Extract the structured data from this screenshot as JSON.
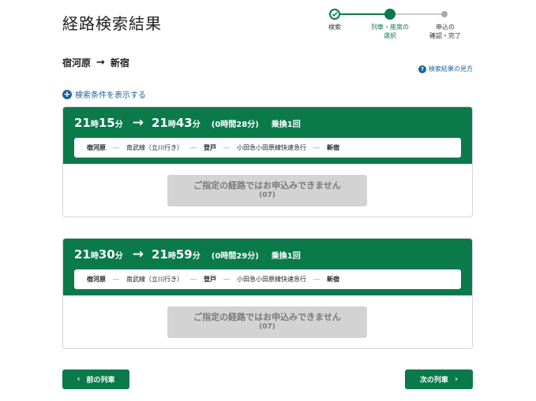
{
  "page": {
    "title": "経路検索結果"
  },
  "stepper": {
    "steps": [
      {
        "label": "検索",
        "state": "done"
      },
      {
        "label": "列車・座席の\n選択",
        "state": "current"
      },
      {
        "label": "申込の\n確認・完了",
        "state": "todo"
      }
    ]
  },
  "route": {
    "from": "宿河原",
    "arrow": "→",
    "to": "新宿"
  },
  "help_link": {
    "label": "検索結果の見方",
    "icon": "question-icon"
  },
  "conditions_link": {
    "label": "検索条件を表示する",
    "icon": "plus-circle-icon"
  },
  "results": [
    {
      "dep_hour": "21",
      "dep_min": "15",
      "arr_hour": "21",
      "arr_min": "43",
      "duration": "(0時間28分)",
      "transfers": "乗換1回",
      "segments": [
        "宿河原",
        "南武線（立川行き）",
        "登戸",
        "小田急小田原線快速急行",
        "新宿"
      ],
      "message": "ご指定の経路ではお申込みできません",
      "code": "(07)"
    },
    {
      "dep_hour": "21",
      "dep_min": "30",
      "arr_hour": "21",
      "arr_min": "59",
      "duration": "(0時間29分)",
      "transfers": "乗換1回",
      "segments": [
        "宿河原",
        "南武線（立川行き）",
        "登戸",
        "小田急小田原線快速急行",
        "新宿"
      ],
      "message": "ご指定の経路ではお申込みできません",
      "code": "(07)"
    }
  ],
  "labels": {
    "hour_unit": "時",
    "min_unit": "分",
    "arrow": "→",
    "dash": "―"
  },
  "buttons": {
    "prev": "前の列車",
    "next": "次の列車"
  },
  "colors": {
    "brand_green": "#0b7a4b",
    "link_blue": "#1f5f9e",
    "disabled_gray": "#d3d3d3"
  }
}
